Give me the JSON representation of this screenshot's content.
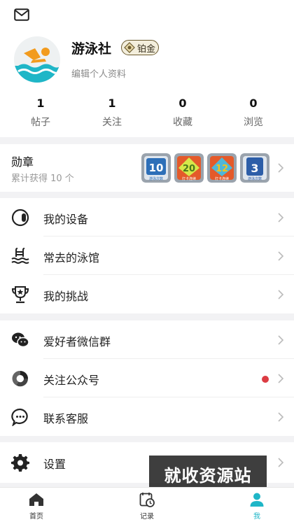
{
  "profile": {
    "username": "游泳社",
    "badge_label": "铂金",
    "edit_label": "编辑个人资料"
  },
  "stats": [
    {
      "value": "1",
      "label": "帖子"
    },
    {
      "value": "1",
      "label": "关注"
    },
    {
      "value": "0",
      "label": "收藏"
    },
    {
      "value": "0",
      "label": "浏览"
    }
  ],
  "medals": {
    "title": "勋章",
    "subtitle": "累计获得 10 个",
    "items": [
      {
        "number": "10",
        "caption": "游泳次数",
        "color": "#2d6fb8"
      },
      {
        "number": "20",
        "caption": "打卡连续",
        "color": "#e45a2a"
      },
      {
        "number": "12",
        "caption": "打卡连续",
        "color": "#e45a2a"
      },
      {
        "number": "3",
        "caption": "游泳次数",
        "color": "#2d5ea8"
      }
    ]
  },
  "menu_group1": [
    {
      "label": "我的设备",
      "icon": "device-icon"
    },
    {
      "label": "常去的泳馆",
      "icon": "pool-icon"
    },
    {
      "label": "我的挑战",
      "icon": "trophy-icon"
    }
  ],
  "menu_group2": [
    {
      "label": "爱好者微信群",
      "icon": "wechat-icon"
    },
    {
      "label": "关注公众号",
      "icon": "official-account-icon",
      "has_dot": true
    },
    {
      "label": "联系客服",
      "icon": "customer-service-icon"
    }
  ],
  "menu_group3": [
    {
      "label": "设置",
      "icon": "gear-icon"
    }
  ],
  "watermark": "就收资源站",
  "tabs": [
    {
      "label": "首页",
      "icon": "home-icon"
    },
    {
      "label": "记录",
      "icon": "record-icon"
    },
    {
      "label": "我",
      "icon": "profile-icon",
      "active": true
    }
  ],
  "colors": {
    "accent": "#1fb6c7",
    "dot": "#dc3c43"
  }
}
